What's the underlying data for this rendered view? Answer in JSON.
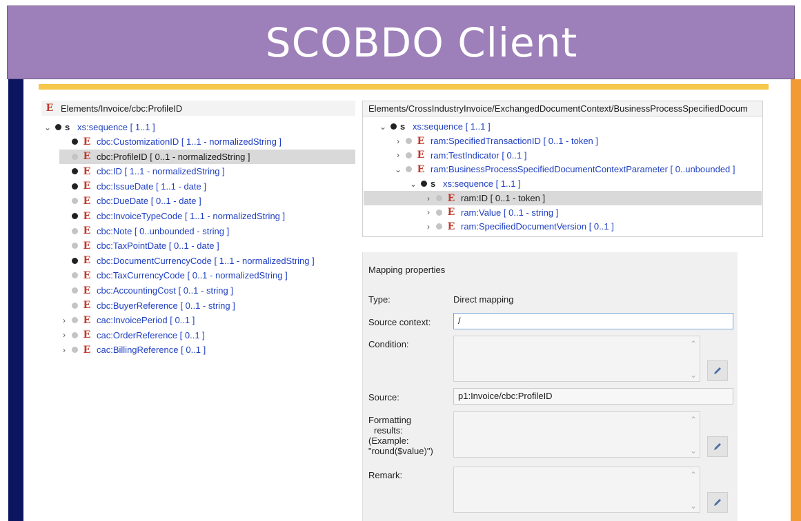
{
  "banner": {
    "title": "SCOBDO Client"
  },
  "left_panel": {
    "header_path": "Elements/Invoice/cbc:ProfileID",
    "root": {
      "prefix": "s",
      "label": "xs:sequence [ 1..1 ]"
    },
    "items": [
      {
        "label": "cbc:CustomizationID [ 1..1 - normalizedString ]",
        "required": true,
        "expandable": false,
        "selected": false
      },
      {
        "label": "cbc:ProfileID [ 0..1 - normalizedString ]",
        "required": false,
        "expandable": false,
        "selected": true
      },
      {
        "label": "cbc:ID [ 1..1 - normalizedString ]",
        "required": true,
        "expandable": false,
        "selected": false
      },
      {
        "label": "cbc:IssueDate [ 1..1 - date ]",
        "required": true,
        "expandable": false,
        "selected": false
      },
      {
        "label": "cbc:DueDate [ 0..1 - date ]",
        "required": false,
        "expandable": false,
        "selected": false
      },
      {
        "label": "cbc:InvoiceTypeCode [ 1..1 - normalizedString ]",
        "required": true,
        "expandable": false,
        "selected": false
      },
      {
        "label": "cbc:Note [ 0..unbounded - string ]",
        "required": false,
        "expandable": false,
        "selected": false
      },
      {
        "label": "cbc:TaxPointDate [ 0..1 - date ]",
        "required": false,
        "expandable": false,
        "selected": false
      },
      {
        "label": "cbc:DocumentCurrencyCode [ 1..1 - normalizedString ]",
        "required": true,
        "expandable": false,
        "selected": false
      },
      {
        "label": "cbc:TaxCurrencyCode [ 0..1 - normalizedString ]",
        "required": false,
        "expandable": false,
        "selected": false
      },
      {
        "label": "cbc:AccountingCost [ 0..1 - string ]",
        "required": false,
        "expandable": false,
        "selected": false
      },
      {
        "label": "cbc:BuyerReference [ 0..1 - string ]",
        "required": false,
        "expandable": false,
        "selected": false
      },
      {
        "label": "cac:InvoicePeriod [ 0..1 ]",
        "required": false,
        "expandable": true,
        "selected": false
      },
      {
        "label": "cac:OrderReference [ 0..1 ]",
        "required": false,
        "expandable": true,
        "selected": false
      },
      {
        "label": "cac:BillingReference [ 0..1 ]",
        "required": false,
        "expandable": true,
        "selected": false
      }
    ]
  },
  "right_panel": {
    "header_path": "Elements/CrossIndustryInvoice/ExchangedDocumentContext/BusinessProcessSpecifiedDocum",
    "root": {
      "prefix": "s",
      "label": "xs:sequence [ 1..1 ]"
    },
    "items": [
      {
        "label": "ram:SpecifiedTransactionID [ 0..1 - token ]",
        "level": 1,
        "expandable": true,
        "expanded": false
      },
      {
        "label": "ram:TestIndicator [ 0..1 ]",
        "level": 1,
        "expandable": true,
        "expanded": false
      },
      {
        "label": "ram:BusinessProcessSpecifiedDocumentContextParameter [ 0..unbounded ]",
        "level": 1,
        "expandable": true,
        "expanded": true
      }
    ],
    "subroot": {
      "prefix": "s",
      "label": "xs:sequence [ 1..1 ]"
    },
    "subitems": [
      {
        "label": "ram:ID [ 0..1 - token ]",
        "selected": true
      },
      {
        "label": "ram:Value [ 0..1 - string ]",
        "selected": false
      },
      {
        "label": "ram:SpecifiedDocumentVersion [ 0..1 ]",
        "selected": false
      }
    ]
  },
  "mapping": {
    "title": "Mapping properties",
    "type_label": "Type:",
    "type_value": "Direct mapping",
    "source_context_label": "Source context:",
    "source_context_value": "/",
    "condition_label": "Condition:",
    "source_label": "Source:",
    "source_value": "p1:Invoice/cbc:ProfileID",
    "formatting_label_1": "Formatting",
    "formatting_label_2": "results:",
    "formatting_label_3": "(Example:",
    "formatting_label_4": "\"round($value)\")",
    "remark_label": "Remark:"
  },
  "colors": {
    "banner": "#9d7fba",
    "left_bar": "#0c1560",
    "right_bar": "#f29a33",
    "gold_line": "#f5c74a",
    "link_blue": "#1f3fc2",
    "element_red": "#c0392b"
  }
}
